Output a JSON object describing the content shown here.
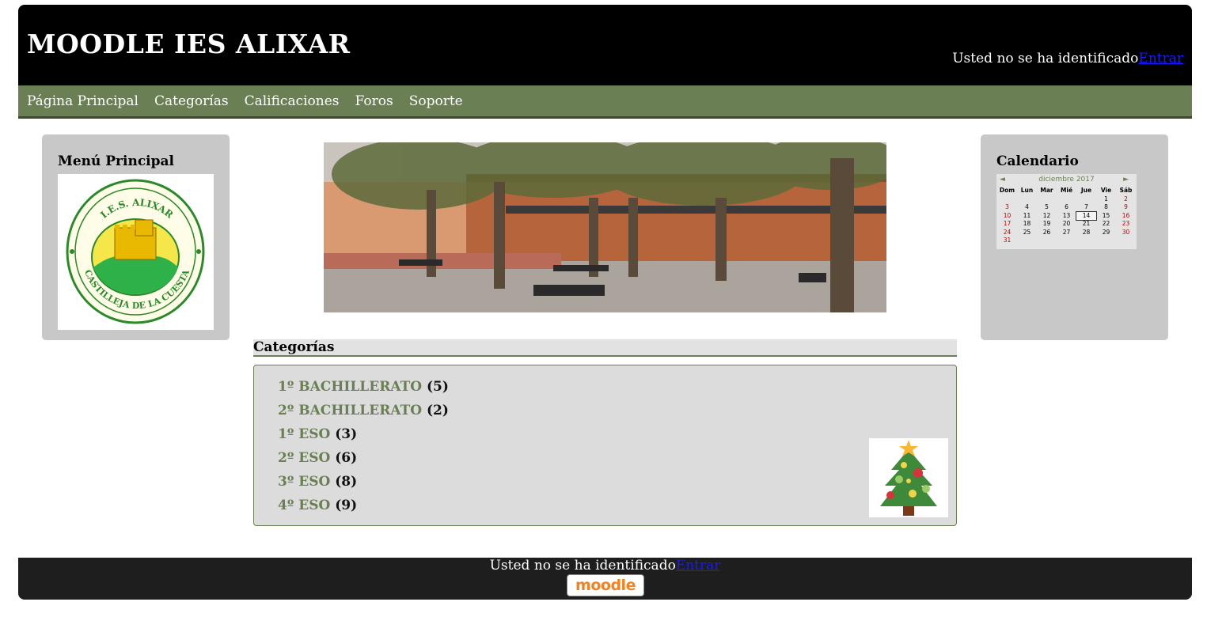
{
  "header": {
    "site_title": "MOODLE IES ALIXAR",
    "login_text": "Usted no se ha identificado",
    "login_link": "Entrar"
  },
  "nav": {
    "items": [
      {
        "label": "Página Principal"
      },
      {
        "label": "Categorías"
      },
      {
        "label": "Calificaciones"
      },
      {
        "label": "Foros"
      },
      {
        "label": "Soporte"
      }
    ]
  },
  "left_block": {
    "title": "Menú Principal",
    "logo_text_top": "I.E.S. ALIXAR",
    "logo_text_bottom": "CASTILLEJA DE LA CUESTA"
  },
  "right_block": {
    "title": "Calendario",
    "calendar": {
      "month": "diciembre 2017",
      "weekdays": [
        "Dom",
        "Lun",
        "Mar",
        "Mié",
        "Jue",
        "Vie",
        "Sáb"
      ],
      "today": "14",
      "weeks": [
        [
          "",
          "",
          "",
          "",
          "",
          "1",
          "2"
        ],
        [
          "3",
          "4",
          "5",
          "6",
          "7",
          "8",
          "9"
        ],
        [
          "10",
          "11",
          "12",
          "13",
          "14",
          "15",
          "16"
        ],
        [
          "17",
          "18",
          "19",
          "20",
          "21",
          "22",
          "23"
        ],
        [
          "24",
          "25",
          "26",
          "27",
          "28",
          "29",
          "30"
        ],
        [
          "31",
          "",
          "",
          "",
          "",
          "",
          ""
        ]
      ]
    }
  },
  "categories": {
    "heading": "Categorías",
    "items": [
      {
        "name": "1º BACHILLERATO",
        "count": "(5)"
      },
      {
        "name": "2º BACHILLERATO",
        "count": "(2)"
      },
      {
        "name": "1º ESO",
        "count": "(3)"
      },
      {
        "name": "2º ESO",
        "count": "(6)"
      },
      {
        "name": "3º ESO",
        "count": "(8)"
      },
      {
        "name": "4º ESO",
        "count": "(9)"
      }
    ]
  },
  "footer": {
    "login_text": "Usted no se ha identificado",
    "login_link": "Entrar",
    "badge": "moodle"
  },
  "colors": {
    "nav_green": "#6b7f55",
    "header_black": "#000000",
    "footer_dark": "#1e1e1e",
    "block_gray": "#c8c8c8",
    "link_blue": "#1a1aff",
    "weekend_red": "#c00000"
  }
}
